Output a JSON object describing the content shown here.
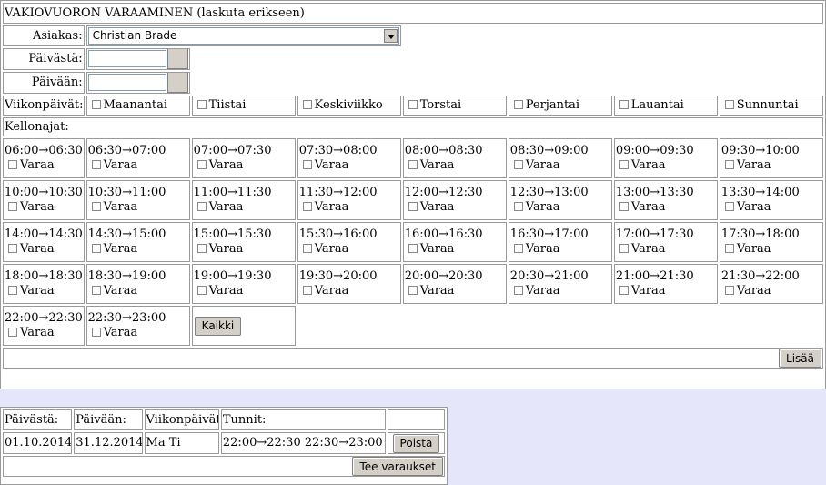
{
  "form": {
    "title": "VAKIOVUORON VARAAMINEN (laskuta erikseen)",
    "customer_label": "Asiakas:",
    "customer_value": "Christian Brade",
    "from_label": "Päivästä:",
    "to_label": "Päivään:",
    "weekdays_label": "Viikonpäivät:",
    "weekdays": [
      "Maanantai",
      "Tiistai",
      "Keskiviikko",
      "Torstai",
      "Perjantai",
      "Lauantai",
      "Sunnuntai"
    ],
    "times_label": "Kellonajat:",
    "book_label": "Varaa",
    "slots": [
      "06:00→06:30",
      "06:30→07:00",
      "07:00→07:30",
      "07:30→08:00",
      "08:00→08:30",
      "08:30→09:00",
      "09:00→09:30",
      "09:30→10:00",
      "10:00→10:30",
      "10:30→11:00",
      "11:00→11:30",
      "11:30→12:00",
      "12:00→12:30",
      "12:30→13:00",
      "13:00→13:30",
      "13:30→14:00",
      "14:00→14:30",
      "14:30→15:00",
      "15:00→15:30",
      "15:30→16:00",
      "16:00→16:30",
      "16:30→17:00",
      "17:00→17:30",
      "17:30→18:00",
      "18:00→18:30",
      "18:30→19:00",
      "19:00→19:30",
      "19:30→20:00",
      "20:00→20:30",
      "20:30→21:00",
      "21:00→21:30",
      "21:30→22:00",
      "22:00→22:30",
      "22:30→23:00"
    ],
    "all_button": "Kaikki",
    "add_button": "Lisää"
  },
  "summary": {
    "headers": [
      "Päivästä:",
      "Päivään:",
      "Viikonpäivät:",
      "Tunnit:"
    ],
    "row": {
      "from": "01.10.2014",
      "to": "31.12.2014",
      "weekdays": "Ma Ti",
      "hours": "22:00→22:30 22:30→23:00",
      "remove_button": "Poista"
    },
    "submit_button": "Tee varaukset"
  }
}
